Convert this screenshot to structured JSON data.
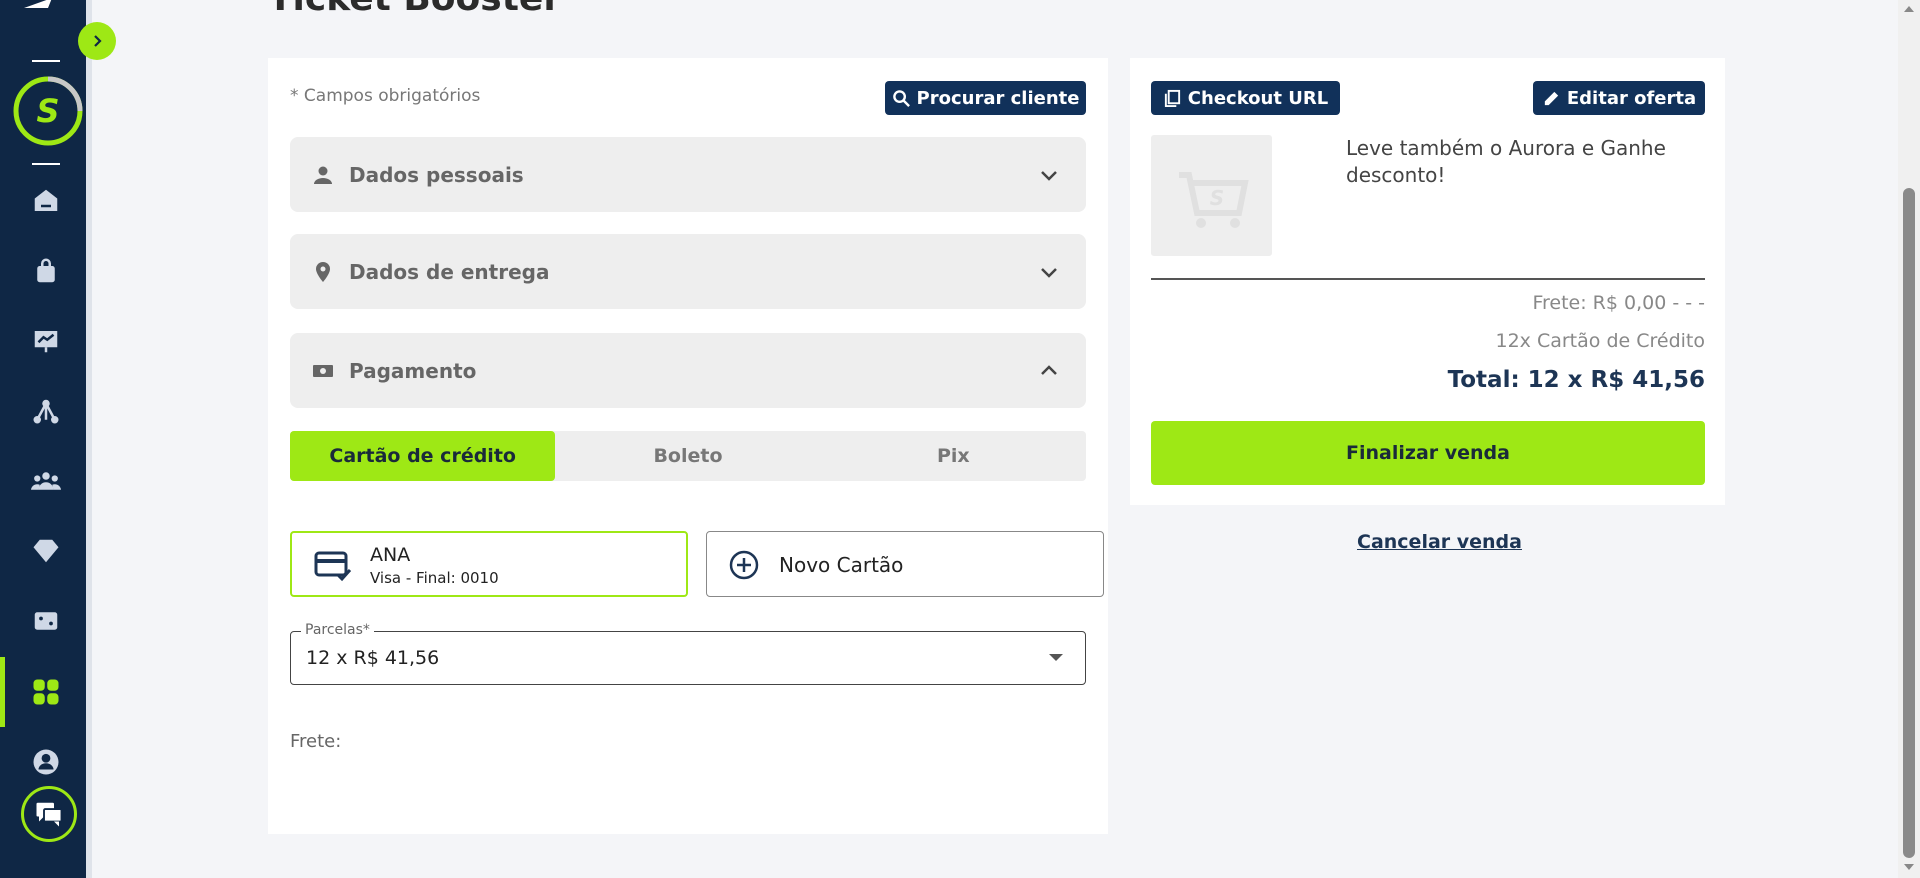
{
  "page": {
    "title": "Ticket Booster"
  },
  "form": {
    "required_note": "* Campos obrigatórios",
    "search_client_label": "Procurar cliente",
    "sections": [
      {
        "label": "Dados pessoais",
        "icon": "person-icon"
      },
      {
        "label": "Dados de entrega",
        "icon": "location-pin-icon"
      },
      {
        "label": "Pagamento",
        "icon": "money-icon"
      }
    ],
    "payment_tabs": [
      "Cartão de crédito",
      "Boleto",
      "Pix"
    ],
    "saved_card": {
      "name": "ANA",
      "detail": "Visa - Final: 0010"
    },
    "new_card_label": "Novo Cartão",
    "installments_field": {
      "label": "Parcelas*",
      "value": "12 x R$ 41,56"
    },
    "frete_label": "Frete:"
  },
  "summary": {
    "checkout_url_label": "Checkout URL",
    "edit_offer_label": "Editar oferta",
    "product_text": "Leve também o Aurora e Ganhe desconto!",
    "frete": "Frete: R$ 0,00 - - -",
    "installments": "12x Cartão de Crédito",
    "total": "Total: 12 x R$ 41,56",
    "finalize_label": "Finalizar venda",
    "cancel_label": "Cancelar venda"
  },
  "colors": {
    "navy": "#0f2745",
    "accent": "#9ee815",
    "button_navy": "#11315a"
  }
}
